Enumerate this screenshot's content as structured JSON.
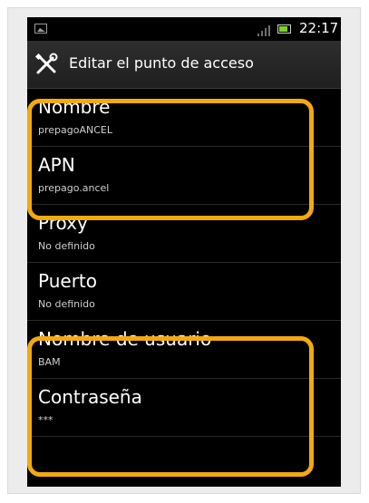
{
  "status_bar": {
    "time": "22:17",
    "icons": [
      "image-notification-icon",
      "signal-icon",
      "battery-icon"
    ],
    "battery_color": "#7ed321"
  },
  "header": {
    "icon": "wrench-screwdriver-icon",
    "title": "Editar el punto de acceso"
  },
  "settings": [
    {
      "title": "Nombre",
      "summary": "prepagoANCEL"
    },
    {
      "title": "APN",
      "summary": "prepago.ancel"
    },
    {
      "title": "Proxy",
      "summary": "No definido"
    },
    {
      "title": "Puerto",
      "summary": "No definido"
    },
    {
      "title": "Nombre de usuario",
      "summary": "BAM"
    },
    {
      "title": "Contraseña",
      "summary": "***"
    }
  ],
  "colors": {
    "highlight": "#f3a90f",
    "background": "#000000",
    "text": "#ffffff",
    "summary_text": "#cfcfcf"
  }
}
